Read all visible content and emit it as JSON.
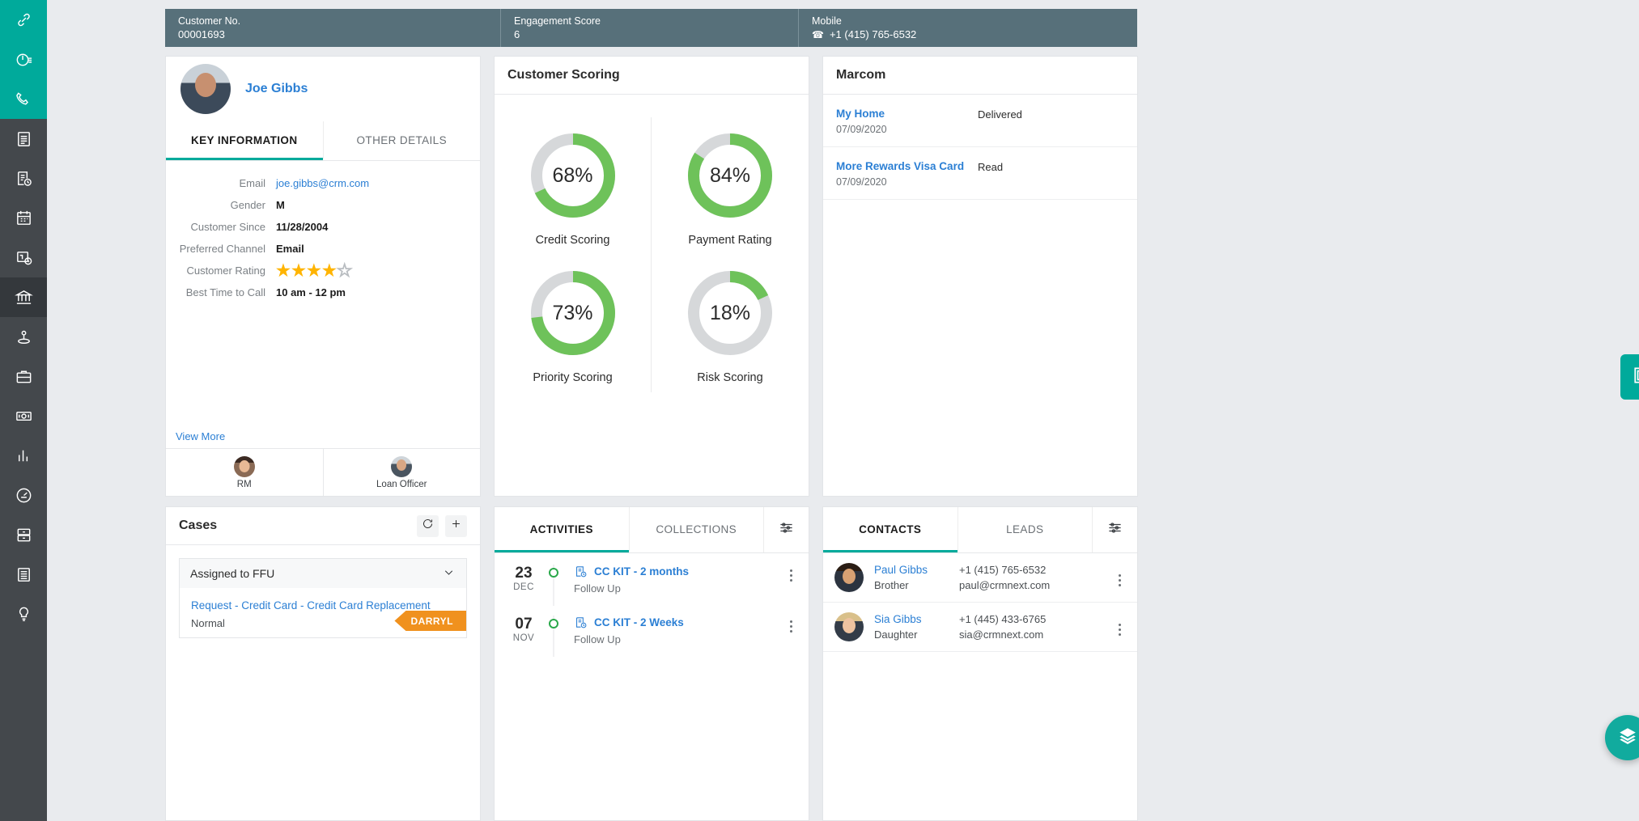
{
  "sidebar": {
    "top_items": [
      {
        "icon": "link-icon",
        "name": "links"
      },
      {
        "icon": "timer-icon",
        "name": "timer"
      },
      {
        "icon": "phone-icon",
        "name": "call"
      }
    ],
    "items": [
      {
        "icon": "notepad-icon",
        "name": "notes"
      },
      {
        "icon": "task-clock-icon",
        "name": "tasks"
      },
      {
        "icon": "calendar-icon",
        "name": "calendar"
      },
      {
        "icon": "schedule-icon",
        "name": "schedule"
      },
      {
        "icon": "bank-icon",
        "name": "bank",
        "active": true
      },
      {
        "icon": "lead-icon",
        "name": "leads"
      },
      {
        "icon": "briefcase-icon",
        "name": "opportunities"
      },
      {
        "icon": "cash-icon",
        "name": "payments"
      },
      {
        "icon": "bar-chart-icon",
        "name": "reports"
      },
      {
        "icon": "dashboard-gauge-icon",
        "name": "dashboard"
      },
      {
        "icon": "drawer-icon",
        "name": "archive"
      },
      {
        "icon": "document-icon",
        "name": "documents"
      },
      {
        "icon": "bulb-icon",
        "name": "insights"
      }
    ]
  },
  "summary": {
    "customer_no_label": "Customer No.",
    "customer_no_value": "00001693",
    "engagement_label": "Engagement Score",
    "engagement_value": "6",
    "mobile_label": "Mobile",
    "mobile_value": "+1 (415) 765-6532"
  },
  "profile": {
    "name": "Joe Gibbs",
    "tabs": [
      {
        "label": "KEY INFORMATION",
        "active": true
      },
      {
        "label": "OTHER DETAILS",
        "active": false
      }
    ],
    "fields": [
      {
        "label": "Email",
        "value": "joe.gibbs@crm.com",
        "type": "link"
      },
      {
        "label": "Gender",
        "value": "M",
        "type": "text"
      },
      {
        "label": "Customer Since",
        "value": "11/28/2004",
        "type": "text"
      },
      {
        "label": "Preferred Channel",
        "value": "Email",
        "type": "text"
      },
      {
        "label": "Customer Rating",
        "value": "4",
        "type": "stars"
      },
      {
        "label": "Best Time to Call",
        "value": "10 am - 12 pm",
        "type": "text"
      }
    ],
    "rating_filled": 4,
    "rating_total": 5,
    "view_more": "View More",
    "owners": [
      {
        "label": "RM"
      },
      {
        "label": "Loan Officer"
      }
    ]
  },
  "scoring": {
    "title": "Customer Scoring"
  },
  "chart_data": {
    "type": "pie",
    "title": "Customer Scoring",
    "legend": "none",
    "colors": {
      "fill": "#6ec25a",
      "track": "#d6d8da"
    },
    "donuts": [
      {
        "label": "Credit Scoring",
        "value": 68,
        "display": "68%",
        "max": 100
      },
      {
        "label": "Payment Rating",
        "value": 84,
        "display": "84%",
        "max": 100
      },
      {
        "label": "Priority Scoring",
        "value": 73,
        "display": "73%",
        "max": 100
      },
      {
        "label": "Risk Scoring",
        "value": 18,
        "display": "18%",
        "max": 100
      }
    ]
  },
  "marcom": {
    "title": "Marcom",
    "rows": [
      {
        "name": "My Home",
        "date": "07/09/2020",
        "status": "Delivered"
      },
      {
        "name": "More Rewards Visa Card",
        "date": "07/09/2020",
        "status": "Read"
      }
    ]
  },
  "cases": {
    "title": "Cases",
    "refresh_icon": "refresh-icon",
    "add_icon": "plus-icon",
    "group_label": "Assigned to FFU",
    "items": [
      {
        "title": "Request - Credit Card - Credit Card Replacement",
        "priority": "Normal",
        "badge": "DARRYL"
      }
    ]
  },
  "activities": {
    "tabs": [
      {
        "label": "ACTIVITIES",
        "active": true
      },
      {
        "label": "COLLECTIONS",
        "active": false
      }
    ],
    "filter_icon": "filter-icon",
    "rows": [
      {
        "day": "23",
        "month": "DEC",
        "title": "CC KIT - 2 months",
        "subtitle": "Follow Up",
        "icon": "task-clock-icon"
      },
      {
        "day": "07",
        "month": "NOV",
        "title": "CC KIT - 2 Weeks",
        "subtitle": "Follow Up",
        "icon": "task-clock-icon"
      }
    ]
  },
  "contacts": {
    "tabs": [
      {
        "label": "CONTACTS",
        "active": true
      },
      {
        "label": "LEADS",
        "active": false
      }
    ],
    "filter_icon": "filter-icon",
    "rows": [
      {
        "name": "Paul Gibbs",
        "relation": "Brother",
        "phone": "+1 (415) 765-6532",
        "email": "paul@crmnext.com"
      },
      {
        "name": "Sia Gibbs",
        "relation": "Daughter",
        "phone": "+1 (445) 433-6765",
        "email": "sia@crmnext.com"
      }
    ]
  },
  "right_controls": {
    "panel_tab_icon": "layout-panel-icon",
    "fab_icon": "layers-icon"
  },
  "colors": {
    "teal": "#00aa9b",
    "summary_bar": "#57707a",
    "link": "#2b7fd4",
    "green": "#6ec25a",
    "orange": "#f0911e"
  }
}
